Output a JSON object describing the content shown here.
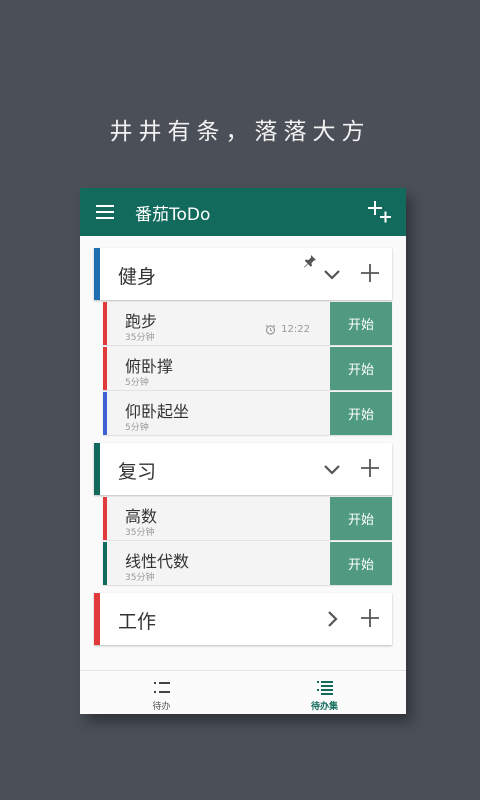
{
  "headline": "井井有条，落落大方",
  "app": {
    "title": "番茄ToDo"
  },
  "colors": {
    "appbar": "#126a5c",
    "start_button": "#4f9a80",
    "blue": "#1e6fb0",
    "teal": "#126a5c",
    "red": "#e03a3a",
    "indigo": "#3f5fd4"
  },
  "groups": [
    {
      "title": "健身",
      "color": "#1e6fb0",
      "expanded": true,
      "pinned": true,
      "tasks": [
        {
          "name": "跑步",
          "duration": "35分钟",
          "alarm": "12:22",
          "color": "#e03a3a",
          "action": "开始"
        },
        {
          "name": "俯卧撑",
          "duration": "5分钟",
          "alarm": "",
          "color": "#e03a3a",
          "action": "开始"
        },
        {
          "name": "仰卧起坐",
          "duration": "5分钟",
          "alarm": "",
          "color": "#3f5fd4",
          "action": "开始"
        }
      ]
    },
    {
      "title": "复习",
      "color": "#126a5c",
      "expanded": true,
      "pinned": false,
      "tasks": [
        {
          "name": "高数",
          "duration": "35分钟",
          "alarm": "",
          "color": "#e03a3a",
          "action": "开始"
        },
        {
          "name": "线性代数",
          "duration": "35分钟",
          "alarm": "",
          "color": "#126a5c",
          "action": "开始"
        }
      ]
    },
    {
      "title": "工作",
      "color": "#e03a3a",
      "expanded": false,
      "pinned": false,
      "tasks": []
    }
  ],
  "nav": {
    "todo": "待办",
    "sets": "待办集"
  }
}
